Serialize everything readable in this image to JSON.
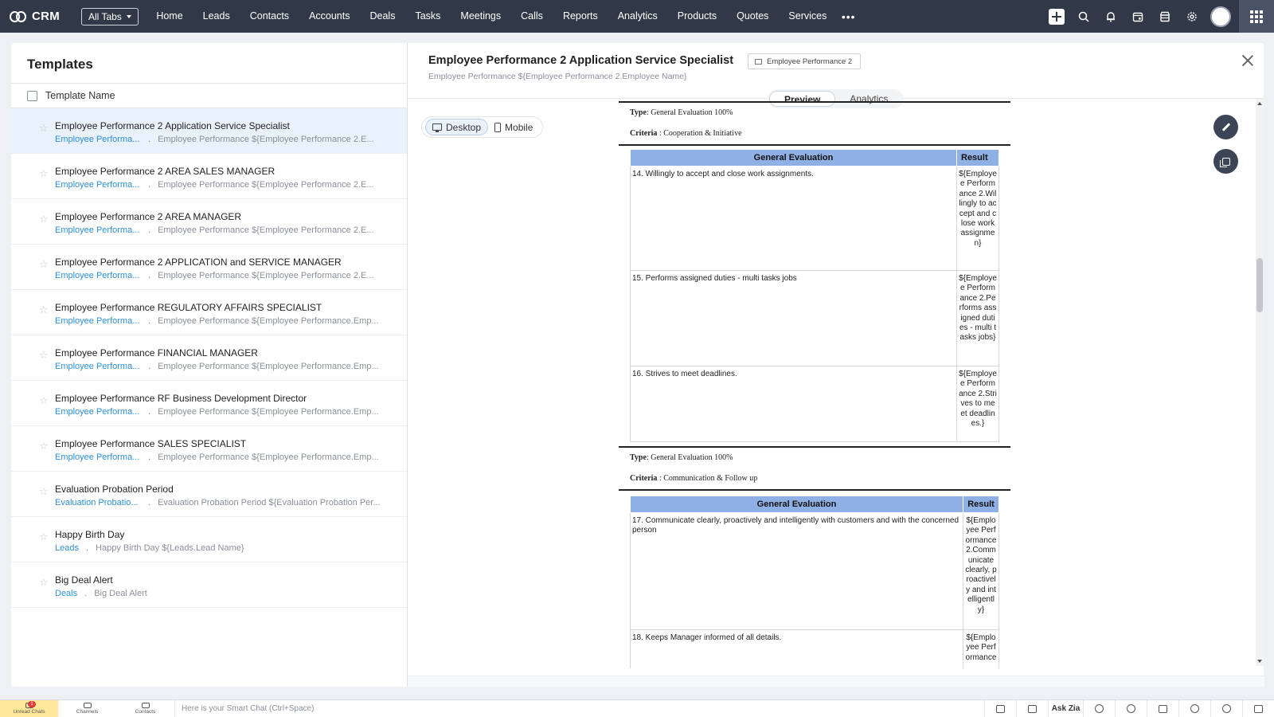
{
  "app": {
    "name": "CRM",
    "all_tabs": "All Tabs"
  },
  "nav_tabs": [
    "Home",
    "Leads",
    "Contacts",
    "Accounts",
    "Deals",
    "Tasks",
    "Meetings",
    "Calls",
    "Reports",
    "Analytics",
    "Products",
    "Quotes",
    "Services"
  ],
  "nav_more": "•••",
  "templates": {
    "title": "Templates",
    "column_header": "Template Name",
    "items": [
      {
        "name": "Employee Performance 2 Application Service Specialist",
        "module": "Employee Performa...",
        "subject": "Employee Performance ${Employee Performance 2.E..."
      },
      {
        "name": "Employee Performance 2 AREA SALES MANAGER",
        "module": "Employee Performa...",
        "subject": "Employee Performance ${Employee Performance 2.E..."
      },
      {
        "name": "Employee Performance 2 AREA MANAGER",
        "module": "Employee Performa...",
        "subject": "Employee Performance ${Employee Performance 2.E..."
      },
      {
        "name": "Employee Performance 2 APPLICATION and SERVICE MANAGER",
        "module": "Employee Performa...",
        "subject": "Employee Performance ${Employee Performance 2.E..."
      },
      {
        "name": "Employee Performance REGULATORY AFFAIRS SPECIALIST",
        "module": "Employee Performa...",
        "subject": "Employee Performance ${Employee Performance.Emp..."
      },
      {
        "name": "Employee Performance FINANCIAL MANAGER",
        "module": "Employee Performa...",
        "subject": "Employee Performance ${Employee Performance.Emp..."
      },
      {
        "name": "Employee Performance RF Business Development Director",
        "module": "Employee Performa...",
        "subject": "Employee Performance ${Employee Performance.Emp..."
      },
      {
        "name": "Employee Performance SALES SPECIALIST",
        "module": "Employee Performa...",
        "subject": "Employee Performance ${Employee Performance.Emp..."
      },
      {
        "name": "Evaluation Probation Period",
        "module": "Evaluation Probatio...",
        "subject": "Evaluation Probation Period ${Evaluation Probation Per..."
      },
      {
        "name": "Happy Birth Day",
        "module": "Leads",
        "subject": "Happy Birth Day ${Leads.Lead Name}"
      },
      {
        "name": "Big Deal Alert",
        "module": "Deals",
        "subject": "Big Deal Alert"
      }
    ]
  },
  "detail": {
    "title": "Employee Performance 2 Application Service Specialist",
    "module_chip": "Employee Performance 2",
    "subject": "Employee Performance ${Employee Performance 2.Employee Name}",
    "tabs": [
      "Preview",
      "Analytics"
    ],
    "view_toggle": [
      "Desktop",
      "Mobile"
    ]
  },
  "document": {
    "section1": {
      "type_label": "Type",
      "type_value": ": General  Evaluation 100%",
      "criteria_label": "Criteria",
      "criteria_value": " : Cooperation & Initiative",
      "header": [
        "General Evaluation",
        "Result"
      ],
      "rows": [
        {
          "q": "14.   Willingly to accept and close work assignments.",
          "r": "${Employee Performance 2.Willingly to accept and close work assignmen}"
        },
        {
          "q": "15.   Performs assigned duties - multi tasks jobs",
          "r": "${Employee Performance 2.Performs assigned duties - multi tasks jobs}"
        },
        {
          "q": "16.   Strives to meet deadlines.",
          "r": "${Employee Performance 2.Strives to meet deadlines.}"
        }
      ]
    },
    "section2": {
      "type_label": "Type",
      "type_value": ": General  Evaluation 100%",
      "criteria_label": "Criteria",
      "criteria_value": " : Communication  & Follow up",
      "header": [
        "General Evaluation",
        "Result"
      ],
      "rows": [
        {
          "q": "17.   Communicate clearly, proactively and intelligently with customers and with the concerned person",
          "r": "${Employee Performance 2.Communicate clearly, proactively and intelligently}"
        },
        {
          "q": "18.   Keeps Manager informed of all details.",
          "r": "${Employee Performance"
        }
      ]
    }
  },
  "bottom_bar": {
    "unread_chats": "Unread Chats",
    "unread_count": "1",
    "channels": "Channels",
    "contacts": "Contacts",
    "smart_chat_placeholder": "Here is your Smart Chat (Ctrl+Space)",
    "ask_zia": "Ask Zia"
  },
  "icons": {
    "nav_right": [
      "plus-icon",
      "search-icon",
      "bell-icon",
      "calendar-icon",
      "store-icon",
      "gear-icon",
      "avatar",
      "apps-icon"
    ],
    "bottom_right": [
      "screen-icon",
      "megaphone-icon",
      "ask-zia",
      "smile-icon",
      "refresh-icon",
      "zia-icon",
      "alarm-icon",
      "history-icon",
      "settings-icon"
    ]
  },
  "colors": {
    "nav_bg": "#313949",
    "accent": "#2d8fd5",
    "table_header": "#8fb0e4",
    "selected_row": "#e9f1fc"
  }
}
